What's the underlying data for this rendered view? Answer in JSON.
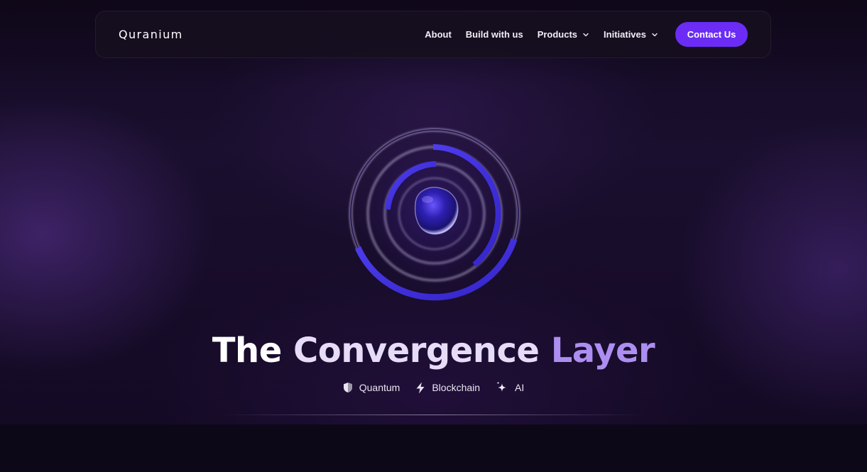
{
  "brand": {
    "logo_text": "Quranium",
    "accent_color": "#6b2cf5"
  },
  "nav": {
    "items": [
      {
        "label": "About",
        "dropdown": false
      },
      {
        "label": "Build with us",
        "dropdown": false
      },
      {
        "label": "Products",
        "dropdown": true,
        "icon": "chevron-down-icon"
      },
      {
        "label": "Initiatives",
        "dropdown": true,
        "icon": "chevron-down-icon"
      }
    ],
    "cta_label": "Contact Us"
  },
  "hero": {
    "graphic": "concentric-rings-orb",
    "headline": {
      "word1": "The",
      "word2": "Convergence",
      "word3": "Layer"
    },
    "tags": [
      {
        "label": "Quantum",
        "icon": "shield-icon"
      },
      {
        "label": "Blockchain",
        "icon": "lightning-icon"
      },
      {
        "label": "AI",
        "icon": "sparkle-icon"
      }
    ]
  }
}
